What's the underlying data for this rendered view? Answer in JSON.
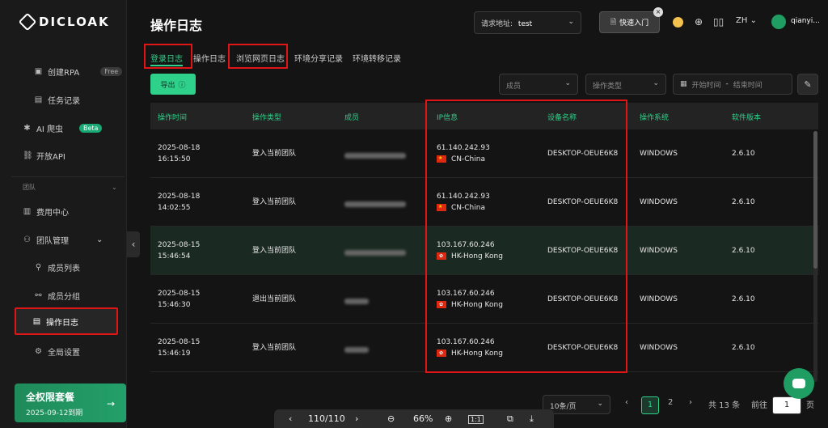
{
  "app": {
    "logo_text": "DICLOAK"
  },
  "sidebar": {
    "items": [
      {
        "label": "创建RPA",
        "badge": "Free"
      },
      {
        "label": "任务记录"
      },
      {
        "label": "AI 爬虫",
        "badge": "Beta"
      },
      {
        "label": "开放API"
      },
      {
        "label": "团队"
      },
      {
        "label": "费用中心"
      },
      {
        "label": "团队管理"
      },
      {
        "label": "成员列表"
      },
      {
        "label": "成员分组"
      },
      {
        "label": "操作日志"
      },
      {
        "label": "全局设置"
      }
    ],
    "plan": {
      "title": "全权限套餐",
      "expiry": "2025-09-12到期"
    }
  },
  "header": {
    "title": "操作日志",
    "request_prefix": "请求地址:",
    "request_value": "test",
    "quick_entry": "快速入门",
    "lang": "ZH",
    "username": "qianyi..."
  },
  "tabs": [
    "登录日志",
    "操作日志",
    "浏览网页日志",
    "环境分享记录",
    "环境转移记录"
  ],
  "toolbar": {
    "export": "导出",
    "member_placeholder": "成员",
    "op_type_placeholder": "操作类型",
    "start_placeholder": "开始时间",
    "range_sep": "-",
    "end_placeholder": "结束时间"
  },
  "table": {
    "columns": [
      "操作时间",
      "操作类型",
      "成员",
      "IP信息",
      "设备名称",
      "操作系统",
      "软件版本"
    ],
    "rows": [
      {
        "date": "2025-08-18",
        "time": "16:15:50",
        "type": "登入当前团队",
        "ip": "61.140.242.93",
        "region": "CN-China",
        "flag": "cn",
        "device": "DESKTOP-OEUE6K8",
        "os": "WINDOWS",
        "version": "2.6.10"
      },
      {
        "date": "2025-08-18",
        "time": "14:02:55",
        "type": "登入当前团队",
        "ip": "61.140.242.93",
        "region": "CN-China",
        "flag": "cn",
        "device": "DESKTOP-OEUE6K8",
        "os": "WINDOWS",
        "version": "2.6.10"
      },
      {
        "date": "2025-08-15",
        "time": "15:46:54",
        "type": "登入当前团队",
        "ip": "103.167.60.246",
        "region": "HK-Hong Kong",
        "flag": "hk",
        "device": "DESKTOP-OEUE6K8",
        "os": "WINDOWS",
        "version": "2.6.10"
      },
      {
        "date": "2025-08-15",
        "time": "15:46:30",
        "type": "退出当前团队",
        "ip": "103.167.60.246",
        "region": "HK-Hong Kong",
        "flag": "hk",
        "device": "DESKTOP-OEUE6K8",
        "os": "WINDOWS",
        "version": "2.6.10"
      },
      {
        "date": "2025-08-15",
        "time": "15:46:19",
        "type": "登入当前团队",
        "ip": "103.167.60.246",
        "region": "HK-Hong Kong",
        "flag": "hk",
        "device": "DESKTOP-OEUE6K8",
        "os": "WINDOWS",
        "version": "2.6.10"
      }
    ]
  },
  "pagination": {
    "page_size": "10条/页",
    "pages": [
      "1",
      "2"
    ],
    "total": "共 13 条",
    "goto_label": "前往",
    "goto_value": "1",
    "page_unit": "页"
  },
  "viewer": {
    "page": "110/110",
    "zoom": "66%",
    "actual_size": "1:1"
  },
  "colors": {
    "accent": "#2fd08a",
    "highlight": "#e01515",
    "background": "#141414"
  }
}
